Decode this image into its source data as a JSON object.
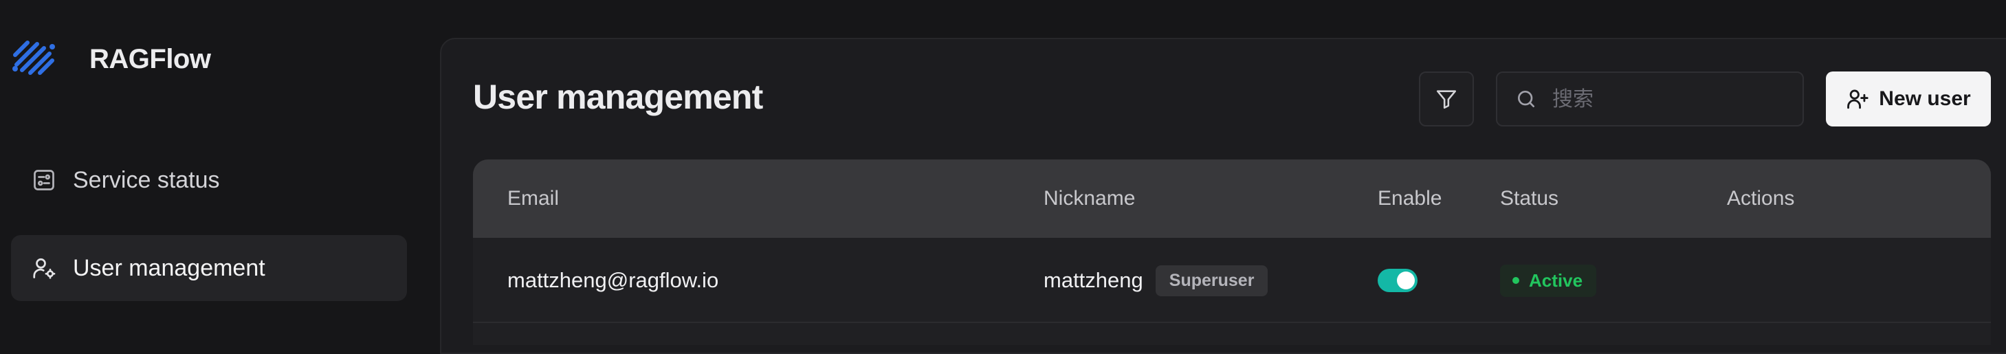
{
  "app": {
    "name": "RAGFlow",
    "accent_color": "#2f6fe4"
  },
  "sidebar": {
    "items": [
      {
        "label": "Service status",
        "icon": "service-status-icon",
        "active": false
      },
      {
        "label": "User management",
        "icon": "user-cog-icon",
        "active": true
      }
    ]
  },
  "page": {
    "title": "User management"
  },
  "toolbar": {
    "filter_icon": "filter-icon",
    "search_placeholder": "搜索",
    "search_value": "",
    "new_user_label": "New user"
  },
  "table": {
    "columns": [
      "Email",
      "Nickname",
      "Enable",
      "Status",
      "Actions"
    ],
    "rows": [
      {
        "email": "mattzheng@ragflow.io",
        "nickname": "mattzheng",
        "role_badge": "Superuser",
        "enabled": true,
        "status": "Active",
        "status_color": "#22c55e"
      }
    ]
  },
  "colors": {
    "background": "#161618",
    "panel": "#1c1c1f",
    "table_header": "#38383b",
    "toggle_on": "#14b8a6"
  }
}
